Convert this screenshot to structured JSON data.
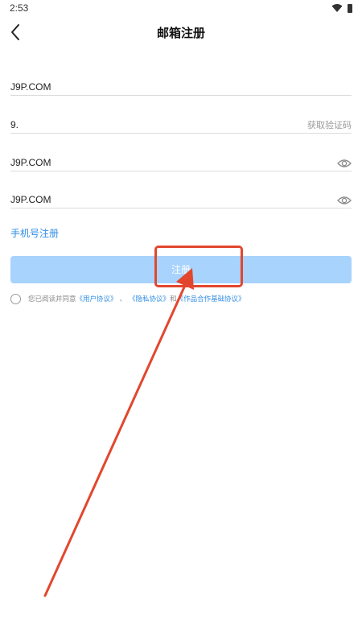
{
  "status_bar": {
    "time": "2:53",
    "icons": [
      "wifi-icon",
      "battery-icon"
    ]
  },
  "header": {
    "back_icon": "chevron-left-icon",
    "title": "邮箱注册"
  },
  "form": {
    "email": {
      "value": "J9P.COM"
    },
    "code": {
      "value": "9.",
      "action_label": "获取验证码"
    },
    "password": {
      "value": "J9P.COM",
      "icon": "eye-icon"
    },
    "confirm_password": {
      "value": "J9P.COM",
      "icon": "eye-icon"
    },
    "phone_register_link": "手机号注册",
    "submit_label": "注册"
  },
  "agreement": {
    "prefix": "您已阅读并同意",
    "user_agreement": "《用户协议》",
    "separator": "、",
    "privacy_agreement": "《隐私协议》",
    "conjunction": "和",
    "cooperation_agreement": "《作品合作基础协议》"
  },
  "colors": {
    "accent": "#2f8de4",
    "submit_bg": "#a7d3fd",
    "annotation": "#e2472e"
  }
}
